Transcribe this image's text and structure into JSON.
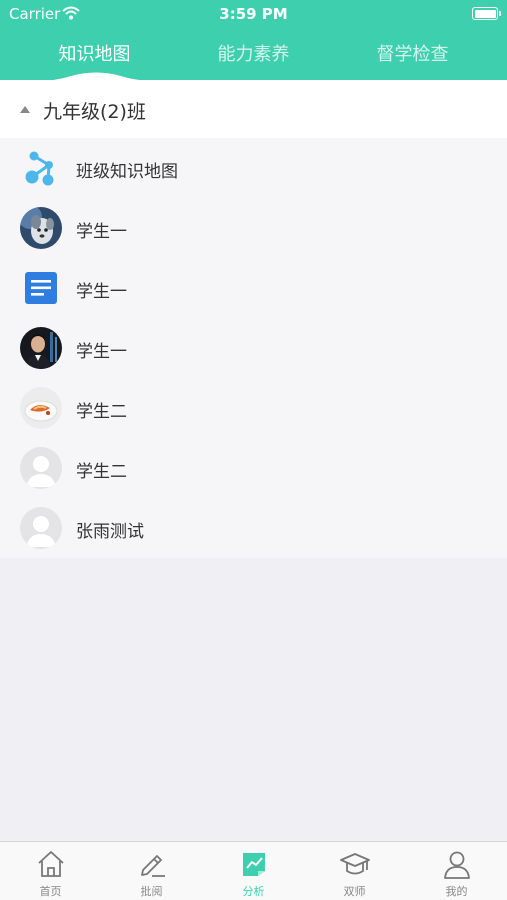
{
  "status_bar": {
    "carrier": "Carrier",
    "time": "3:59 PM"
  },
  "tabs": [
    {
      "label": "知识地图",
      "active": true
    },
    {
      "label": "能力素养",
      "active": false
    },
    {
      "label": "督学检查",
      "active": false
    }
  ],
  "class_section": {
    "title": "九年级(2)班",
    "expanded": true
  },
  "rows": [
    {
      "label": "班级知识地图",
      "icon": "knowledge-map-icon"
    },
    {
      "label": "学生一",
      "icon": "dog-photo-avatar"
    },
    {
      "label": "学生一",
      "icon": "document-icon"
    },
    {
      "label": "学生一",
      "icon": "man-photo-avatar"
    },
    {
      "label": "学生二",
      "icon": "food-photo-avatar"
    },
    {
      "label": "学生二",
      "icon": "default-avatar"
    },
    {
      "label": "张雨测试",
      "icon": "default-avatar"
    }
  ],
  "bottom_nav": [
    {
      "label": "首页",
      "icon": "home-icon"
    },
    {
      "label": "批阅",
      "icon": "pen-icon"
    },
    {
      "label": "分析",
      "icon": "analysis-chart-icon",
      "active": true
    },
    {
      "label": "双师",
      "icon": "graduation-cap-icon"
    },
    {
      "label": "我的",
      "icon": "person-icon"
    }
  ],
  "colors": {
    "primary": "#3ecfae",
    "background": "#efeff4",
    "list_background": "#f6f6f8",
    "document_blue": "#2f7de1"
  }
}
